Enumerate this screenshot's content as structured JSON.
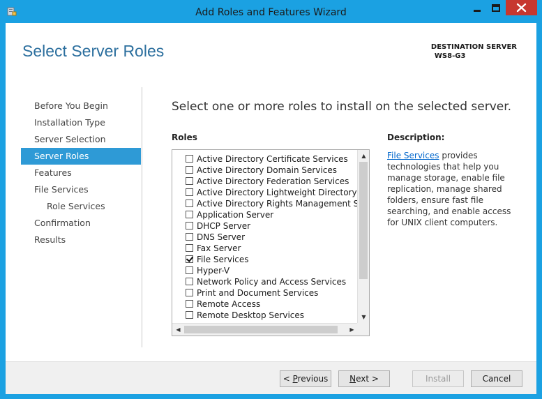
{
  "window": {
    "title": "Add Roles and Features Wizard",
    "icon": "server-manager-icon",
    "controls": [
      "minimize-icon",
      "maximize-icon",
      "close-icon"
    ]
  },
  "header": {
    "page_title": "Select Server Roles",
    "destination_label": "DESTINATION SERVER",
    "destination_server": "WS8-G3"
  },
  "nav": {
    "items": [
      {
        "label": "Before You Begin"
      },
      {
        "label": "Installation Type"
      },
      {
        "label": "Server Selection"
      },
      {
        "label": "Server Roles",
        "active": true
      },
      {
        "label": "Features"
      },
      {
        "label": "File Services"
      },
      {
        "label": "Role Services",
        "sub": true
      },
      {
        "label": "Confirmation"
      },
      {
        "label": "Results"
      }
    ]
  },
  "main": {
    "heading": "Select one or more roles to install on the selected server.",
    "roles_label": "Roles",
    "roles": [
      {
        "label": "Active Directory Certificate Services",
        "checked": false
      },
      {
        "label": "Active Directory Domain Services",
        "checked": false
      },
      {
        "label": "Active Directory Federation Services",
        "checked": false
      },
      {
        "label": "Active Directory Lightweight Directory Servi",
        "checked": false
      },
      {
        "label": "Active Directory Rights Management Service",
        "checked": false
      },
      {
        "label": "Application Server",
        "checked": false
      },
      {
        "label": "DHCP Server",
        "checked": false
      },
      {
        "label": "DNS Server",
        "checked": false
      },
      {
        "label": "Fax Server",
        "checked": false
      },
      {
        "label": "File Services",
        "checked": true
      },
      {
        "label": "Hyper-V",
        "checked": false
      },
      {
        "label": "Network Policy and Access Services",
        "checked": false
      },
      {
        "label": "Print and Document Services",
        "checked": false
      },
      {
        "label": "Remote Access",
        "checked": false
      },
      {
        "label": "Remote Desktop Services",
        "checked": false
      }
    ],
    "description_label": "Description:",
    "description_link": "File Services",
    "description_text": " provides technologies that help you manage storage, enable file replication, manage shared folders, ensure fast file searching, and enable access for UNIX client computers."
  },
  "footer": {
    "previous_prefix": "< ",
    "previous_key": "P",
    "previous_rest": "revious",
    "next_key": "N",
    "next_rest": "ext >",
    "install_label": "Install",
    "cancel_label": "Cancel"
  },
  "colors": {
    "window_border": "#1ba1e2",
    "title_accent": "#2c6f9e",
    "nav_active": "#2e9ad6",
    "close_button": "#c7372f",
    "link": "#0066cc"
  }
}
